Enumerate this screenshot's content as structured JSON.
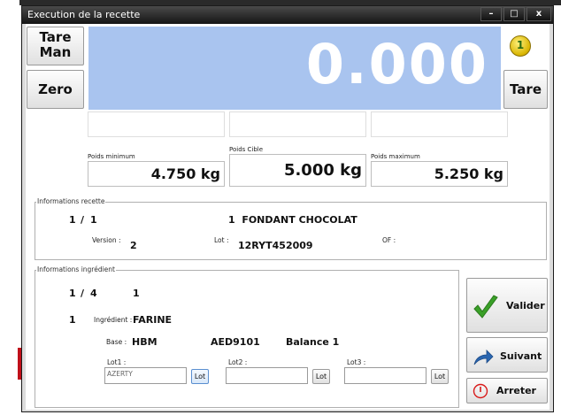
{
  "window": {
    "title": "Execution de la recette"
  },
  "titlebar_buttons": {
    "minimize": "–",
    "maximize": "□",
    "close": "x"
  },
  "buttons": {
    "tare_man_line1": "Tare",
    "tare_man_line2": "Man",
    "zero": "Zero",
    "tare": "Tare"
  },
  "display": {
    "value": "0.000",
    "scale_badge": "1"
  },
  "weights": {
    "min_label": "Poids minimum",
    "min_value": "4.750 kg",
    "target_label": "Poids Cible",
    "target_value": "5.000 kg",
    "max_label": "Poids maximum",
    "max_value": "5.250 kg"
  },
  "recipe": {
    "section_title": "Informations recette",
    "step": "1",
    "step_sep": "/",
    "step_total": "1",
    "recipe_line": "1  FONDANT CHOCOLAT",
    "version_label": "Version :",
    "version_value": "2",
    "lot_label": "Lot :",
    "lot_value": "12RYT452009",
    "of_label": "OF :",
    "of_value": ""
  },
  "ingredient": {
    "section_title": "Informations ingrédient",
    "step": "1",
    "step_sep": "/",
    "step_total": "4",
    "count": "1",
    "row_index": "1",
    "ingredient_label": "Ingrédient :",
    "ingredient_value": "FARINE",
    "base_label": "Base :",
    "base_value": "HBM",
    "device": "AED9101",
    "balance": "Balance 1",
    "lot1_label": "Lot1 :",
    "lot1_value": "AZERTY",
    "lot2_label": "Lot2 :",
    "lot2_value": "",
    "lot3_label": "Lot3 :",
    "lot3_value": "",
    "lot_button": "Lot"
  },
  "actions": {
    "validate": "Valider",
    "next": "Suivant",
    "stop": "Arreter"
  },
  "colors": {
    "display_bg": "#a9c4ef",
    "validate_check": "#3aa028",
    "next_arrow": "#2a66b0",
    "stop_icon": "#d81a1a"
  }
}
